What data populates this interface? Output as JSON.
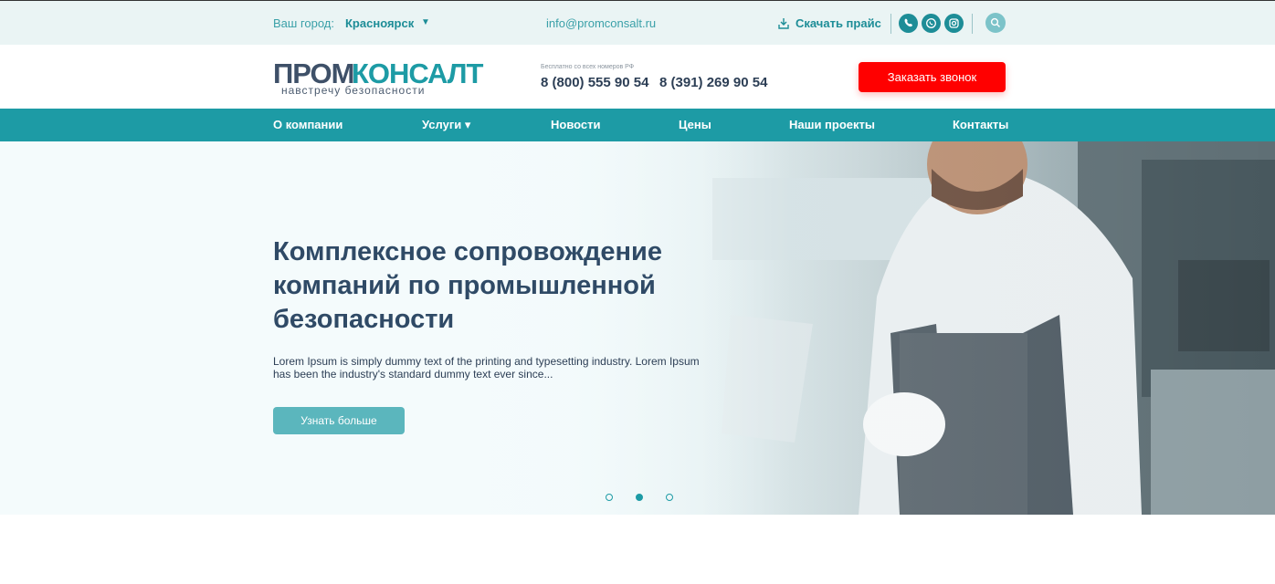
{
  "topbar": {
    "city_label": "Ваш город:",
    "city_value": "Красноярск",
    "email": "info@promconsalt.ru",
    "price_label": "Скачать прайс",
    "social_icons": [
      "viber-icon",
      "whatsapp-icon",
      "instagram-icon"
    ]
  },
  "header": {
    "logo_part1": "ПРОМ",
    "logo_part2": "КОНСАЛТ",
    "logo_tagline": "навстречу безопасности",
    "phone_note": "Бесплатно со всех номеров РФ",
    "phone1": "8 (800) 555 90 54",
    "phone2": "8 (391) 269 90 54",
    "callback_label": "Заказать звонок"
  },
  "nav": {
    "items": [
      {
        "label": "О компании"
      },
      {
        "label": "Услуги ▾"
      },
      {
        "label": "Новости"
      },
      {
        "label": "Цены"
      },
      {
        "label": "Наши проекты"
      },
      {
        "label": "Контакты"
      }
    ]
  },
  "hero": {
    "title": "Комплексное сопровождение компаний по промышленной безопасности",
    "text": "Lorem Ipsum is simply dummy text of the printing and typesetting industry. Lorem Ipsum has been the industry's standard dummy text ever since...",
    "button_label": "Узнать больше",
    "slide_count": 3,
    "active_slide": 2
  },
  "colors": {
    "accent": "#1d9ba5",
    "callback": "#ff0000",
    "title": "#2f4a66"
  }
}
